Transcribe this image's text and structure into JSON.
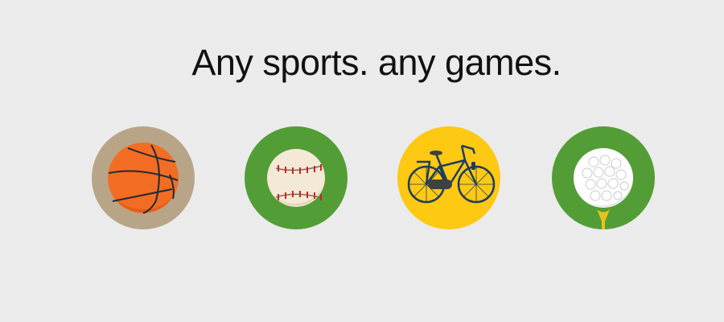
{
  "headline": "Any sports. any games.",
  "sports": [
    {
      "icon": "basketball-icon",
      "color": "#b8a588"
    },
    {
      "icon": "baseball-icon",
      "color": "#539d36"
    },
    {
      "icon": "bicycle-icon",
      "color": "#fdc913"
    },
    {
      "icon": "golf-ball-icon",
      "color": "#539d36"
    }
  ]
}
